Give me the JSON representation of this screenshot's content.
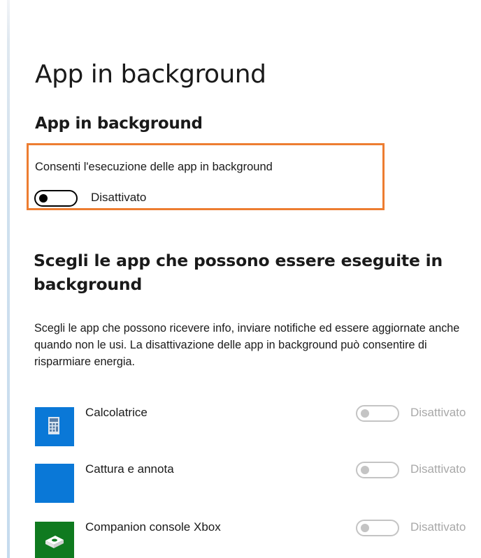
{
  "page": {
    "title": "App in background",
    "section_title": "App in background"
  },
  "master": {
    "description": "Consenti l'esecuzione delle app in background",
    "state": "Disattivato",
    "enabled": false,
    "highlight_color": "#ed7d31"
  },
  "apps_section": {
    "heading": "Scegli le app che possono essere eseguite in background",
    "description": "Scegli le app che possono ricevere info, inviare notifiche ed essere aggiornate anche quando non le usi. La disattivazione delle app in background può consentire di risparmiare energia."
  },
  "apps": [
    {
      "name": "Calcolatrice",
      "state": "Disattivato",
      "enabled": false,
      "icon": "calculator-icon",
      "tile_color": "#0a78d7"
    },
    {
      "name": "Cattura e annota",
      "state": "Disattivato",
      "enabled": false,
      "icon": "snip-sketch-icon",
      "tile_color": "#0a78d7"
    },
    {
      "name": "Companion console Xbox",
      "state": "Disattivato",
      "enabled": false,
      "icon": "xbox-console-icon",
      "tile_color": "#0f7a1f"
    }
  ],
  "colors": {
    "accent_blue": "#0a78d7",
    "xbox_green": "#0f7a1f",
    "disabled_gray": "#c4c4c4"
  }
}
